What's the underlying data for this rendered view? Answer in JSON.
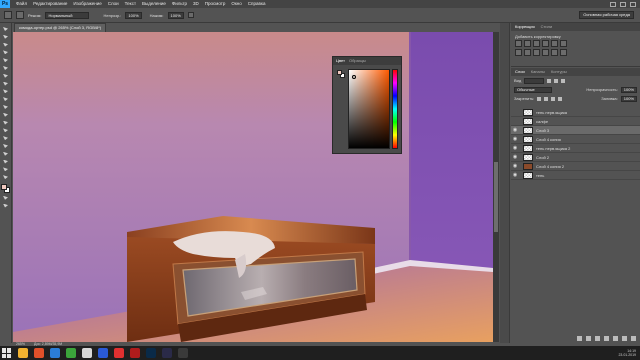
{
  "menu": {
    "app_logo": "Ps",
    "items": [
      "Файл",
      "Редактирование",
      "Изображение",
      "Слои",
      "Текст",
      "Выделение",
      "Фильтр",
      "3D",
      "Просмотр",
      "Окно",
      "Справка"
    ]
  },
  "options": {
    "mode_label": "Режим:",
    "mode_value": "Нормальный",
    "opacity_label": "Непрозр.:",
    "opacity_value": "100%",
    "flow_label": "Нажим:",
    "flow_value": "100%",
    "workspace": "Основная рабочая среда"
  },
  "document": {
    "tab_title": "комода-ортер.psd @ 265% (Слой 3, RGB/8*)",
    "status_zoom": "265%",
    "status_doc": "Док: 2,89M/35,9M"
  },
  "color_panel": {
    "tabs": [
      "Цвет",
      "Образцы"
    ],
    "foreground": "#f0c8be",
    "background": "#ffffff"
  },
  "nav_panel": {
    "tabs": [
      "Коррекция",
      "Стили"
    ],
    "heading": "Добавить корректировку"
  },
  "layers_panel": {
    "tabs": [
      "Слои",
      "Каналы",
      "Контуры"
    ],
    "filter_label": "Вид",
    "blend_mode": "Обычные",
    "opacity_label": "Непрозрачность:",
    "opacity_value": "100%",
    "lock_label": "Закрепить:",
    "fill_label": "Заливка:",
    "fill_value": "100%",
    "layers": [
      {
        "name": "тень перв.ящика",
        "visible": false,
        "selected": false,
        "thumb": "checker"
      },
      {
        "name": "салфе",
        "visible": false,
        "selected": false,
        "thumb": "checker"
      },
      {
        "name": "Слой 3",
        "visible": true,
        "selected": true,
        "thumb": "checker"
      },
      {
        "name": "Слой 4 копия",
        "visible": true,
        "selected": false,
        "thumb": "checker"
      },
      {
        "name": "тень перв.ящика 2",
        "visible": true,
        "selected": false,
        "thumb": "checker"
      },
      {
        "name": "Слой 2",
        "visible": true,
        "selected": false,
        "thumb": "checker"
      },
      {
        "name": "Слой 4 копия 2",
        "visible": true,
        "selected": false,
        "thumb": "color"
      },
      {
        "name": "тень",
        "visible": true,
        "selected": false,
        "thumb": "checker"
      }
    ]
  },
  "taskbar": {
    "time": "14:19",
    "date": "23.01.2019"
  }
}
